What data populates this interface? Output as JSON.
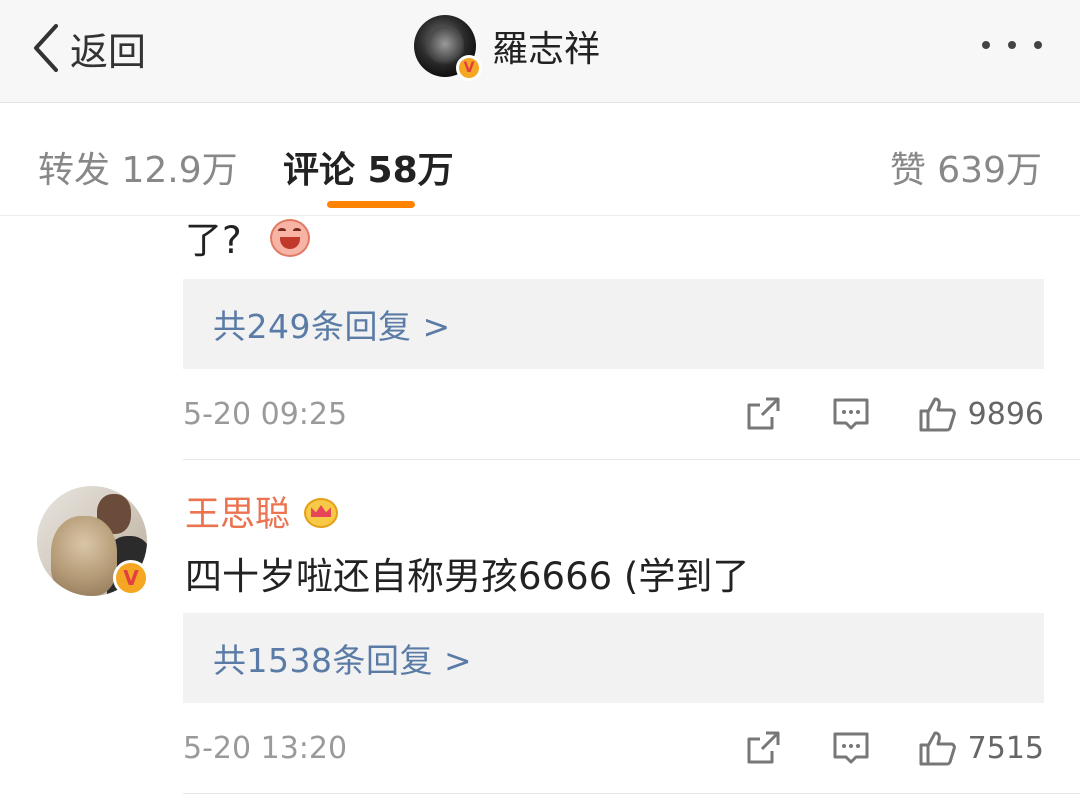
{
  "navbar": {
    "back_label": "返回",
    "profile_name": "羅志祥",
    "verified_badge": "V"
  },
  "tabs": {
    "repost": "转发 12.9万",
    "comment": "评论 58万",
    "like": "赞 639万"
  },
  "comments": [
    {
      "text_tail": "了?",
      "emoji": "laughing-pig-emoji",
      "replies_label": "共249条回复 >",
      "time": "5-20 09:25",
      "likes": "9896"
    },
    {
      "author": "王思聪",
      "author_badge": "crown-icon",
      "verified_badge": "V",
      "text": "四十岁啦还自称男孩6666 (学到了",
      "replies_label": "共1538条回复 >",
      "time": "5-20 13:20",
      "likes": "7515"
    }
  ],
  "colors": {
    "accent": "#ff8200",
    "reply_link": "#5a7ba6",
    "author_name": "#eb7350",
    "verified": "#f5a623"
  }
}
